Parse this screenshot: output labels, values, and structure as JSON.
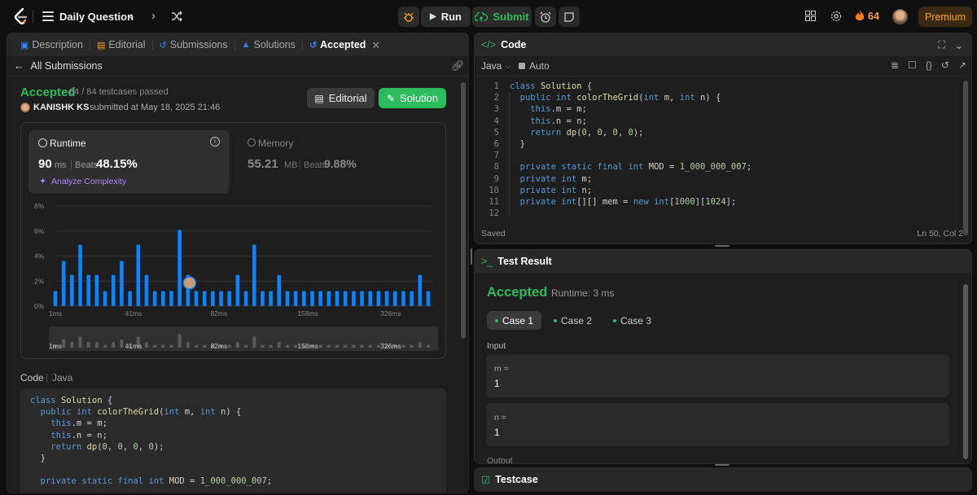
{
  "topbar": {
    "title": "Daily Question",
    "run_label": "Run",
    "submit_label": "Submit",
    "streak": "64",
    "premium_label": "Premium"
  },
  "left_tabs": [
    "Description",
    "Editorial",
    "Submissions",
    "Solutions",
    "Accepted"
  ],
  "subheader": {
    "back_label": "All Submissions"
  },
  "result": {
    "status": "Accepted",
    "testcases": "84 / 84 testcases passed",
    "user": "KANISHK KS",
    "submitted": "submitted at May 18, 2025 21:46",
    "editorial_label": "Editorial",
    "solution_label": "Solution"
  },
  "runtime": {
    "label": "Runtime",
    "value": "90",
    "unit": "ms",
    "beats_label": "Beats",
    "beats": "48.15%",
    "analyze_label": "Analyze Complexity"
  },
  "memory": {
    "label": "Memory",
    "value": "55.21",
    "unit": "MB",
    "beats_label": "Beats",
    "beats": "9.88%"
  },
  "chart_data": {
    "type": "bar",
    "ylabel": "",
    "xlabel": "",
    "yticks": [
      "8%",
      "6%",
      "4%",
      "2%",
      "0%"
    ],
    "ylim": [
      0,
      8
    ],
    "xticks": [
      "1ms",
      "41ms",
      "82ms",
      "158ms",
      "326ms"
    ],
    "highlight_index": 15,
    "values": [
      1.2,
      3.6,
      2.5,
      4.9,
      2.5,
      2.5,
      1.2,
      2.5,
      3.6,
      1.2,
      4.9,
      2.5,
      1.2,
      1.2,
      1.2,
      6.1,
      2.5,
      1.2,
      1.2,
      1.2,
      1.2,
      1.2,
      2.5,
      1.2,
      4.9,
      1.2,
      1.2,
      2.5,
      1.2,
      1.2,
      1.2,
      1.2,
      1.2,
      1.2,
      1.2,
      1.2,
      1.2,
      1.2,
      1.2,
      1.2,
      1.2,
      1.2,
      1.2,
      1.2,
      2.5,
      1.2
    ]
  },
  "code_view": {
    "header_label": "Code",
    "lang_label": "Java",
    "lines": [
      "class Solution {",
      "  public int colorTheGrid(int m, int n) {",
      "    this.m = m;",
      "    this.n = n;",
      "    return dp(0, 0, 0, 0);",
      "  }",
      "",
      "  private static final int MOD = 1_000_000_007;"
    ]
  },
  "editor": {
    "title": "Code",
    "language": "Java",
    "mode": "Auto",
    "line_numbers": [
      "1",
      "2",
      "3",
      "4",
      "5",
      "6",
      "7",
      "8",
      "9",
      "10",
      "11",
      "12"
    ],
    "lines": [
      "class Solution {",
      "  public int colorTheGrid(int m, int n) {",
      "    this.m = m;",
      "    this.n = n;",
      "    return dp(0, 0, 0, 0);",
      "  }",
      "",
      "  private static final int MOD = 1_000_000_007;",
      "  private int m;",
      "  private int n;",
      "  private int[][] mem = new int[1000][1024];",
      ""
    ],
    "status": "Saved",
    "cursor": "Ln 50, Col 2"
  },
  "test_result": {
    "title": "Test Result",
    "status": "Accepted",
    "runtime": "Runtime: 3 ms",
    "cases": [
      "Case 1",
      "Case 2",
      "Case 3"
    ],
    "input_label": "Input",
    "inputs": [
      {
        "name": "m =",
        "value": "1"
      },
      {
        "name": "n =",
        "value": "1"
      }
    ],
    "output_label": "Output"
  },
  "testcase": {
    "title": "Testcase"
  },
  "colors": {
    "accent_green": "#2cbb5d",
    "bar_blue": "#0a84ff",
    "premium": "#ffa116"
  }
}
